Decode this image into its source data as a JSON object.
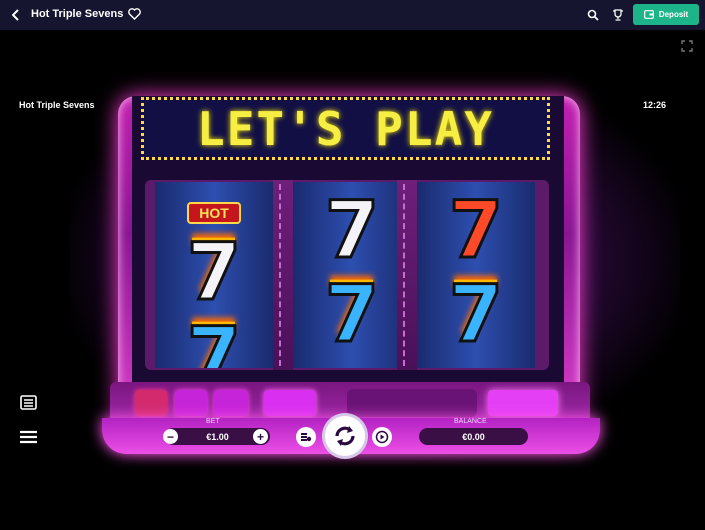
{
  "topbar": {
    "title": "Hot Triple Sevens",
    "back_icon": "chevron-left-icon",
    "favorite_icon": "heart-icon",
    "search_icon": "search-icon",
    "trophy_icon": "trophy-icon",
    "deposit_label": "Deposit",
    "deposit_color": "#1db489"
  },
  "game": {
    "hud_title": "Hot Triple Sevens",
    "clock": "12:26",
    "marquee": "LET'S PLAY",
    "reels": [
      {
        "symbols": [
          "HOT",
          "7",
          "7"
        ],
        "colors": [
          "#c4161c",
          "#f4f4f8",
          "#3bb4ff"
        ]
      },
      {
        "symbols": [
          "7",
          "7"
        ],
        "colors": [
          "#f4f4f8",
          "#3bb4ff"
        ]
      },
      {
        "symbols": [
          "7",
          "7"
        ],
        "colors": [
          "#ff4a2a",
          "#3bb4ff"
        ]
      }
    ],
    "controls": {
      "bet_label": "BET",
      "bet_value": "€1.00",
      "balance_label": "BALANCE",
      "balance_value": "€0.00",
      "minus": "−",
      "plus": "+"
    }
  }
}
